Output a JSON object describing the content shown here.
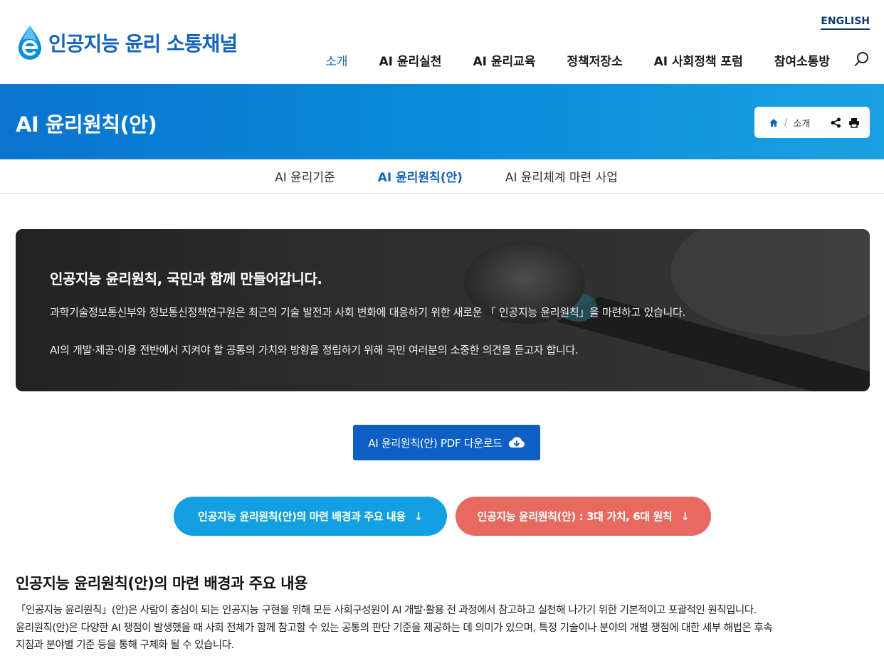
{
  "header": {
    "logo_text": "인공지능 윤리 소통채널",
    "english_link": "ENGLISH",
    "nav": [
      {
        "label": "소개",
        "active": true
      },
      {
        "label": "AI 윤리실천",
        "active": false
      },
      {
        "label": "AI 윤리교육",
        "active": false
      },
      {
        "label": "정책저장소",
        "active": false
      },
      {
        "label": "AI 사회정책 포럼",
        "active": false
      },
      {
        "label": "참여소통방",
        "active": false
      }
    ]
  },
  "banner": {
    "title": "AI 윤리원칙(안)",
    "breadcrumb": {
      "home_icon": "home-icon",
      "separator": "/",
      "current": "소개"
    },
    "actions": [
      "share-icon",
      "print-icon"
    ]
  },
  "subtabs": [
    {
      "label": "AI 윤리기준",
      "active": false
    },
    {
      "label": "AI 윤리원칙(안)",
      "active": true
    },
    {
      "label": "AI 윤리체계 마련 사업",
      "active": false
    }
  ],
  "hero": {
    "title": "인공지능 윤리원칙, 국민과 함께 만들어갑니다.",
    "paragraph1": "과학기술정보통신부와 정보통신정책연구원은 최근의 기술 발전과 사회 변화에 대응하기 위한 새로운 「 인공지능 윤리원칙」을 마련하고 있습니다.",
    "paragraph2": "AI의 개발·제공·이용 전반에서 지켜야 할 공통의 가치와 방향을 정립하기 위해 국민 여러분의 소중한 의견을 듣고자 합니다."
  },
  "pdf_button": {
    "label": "AI 윤리원칙(안) PDF 다운로드",
    "icon": "cloud-download-icon"
  },
  "anchor_buttons": [
    {
      "label": "인공지능 윤리원칙(안)의 마련 배경과 주요 내용",
      "arrow": "↓",
      "color": "#13a0e2"
    },
    {
      "label": "인공지능 윤리원칙(안) : 3대 가치, 6대 원칙",
      "arrow": "↓",
      "color": "#e8695f"
    }
  ],
  "section": {
    "title": "인공지능 윤리원칙(안)의 마련 배경과 주요 내용",
    "lines": [
      "「인공지능 윤리원칙」(안)은 사람이 중심이 되는 인공지능 구현을 위해 모든 사회구성원이 AI 개발·활용 전 과정에서 참고하고 실천해 나가기 위한 기본적이고 포괄적인 원칙입니다.",
      "윤리원칙(안)은 다양한 AI 쟁점이 발생했을 때 사회 전체가 함께 참고할 수 있는 공통의 판단 기준을 제공하는 데 의미가 있으며, 특정 기술이나 분야의 개별 쟁점에 대한 세부 해법은 후속",
      "지침과 분야별 기준 등을 통해 구체화 될 수 있습니다."
    ]
  },
  "colors": {
    "brand": "#1463b8",
    "banner": "#0a8ddb",
    "pdf_button": "#0d5fc4"
  }
}
